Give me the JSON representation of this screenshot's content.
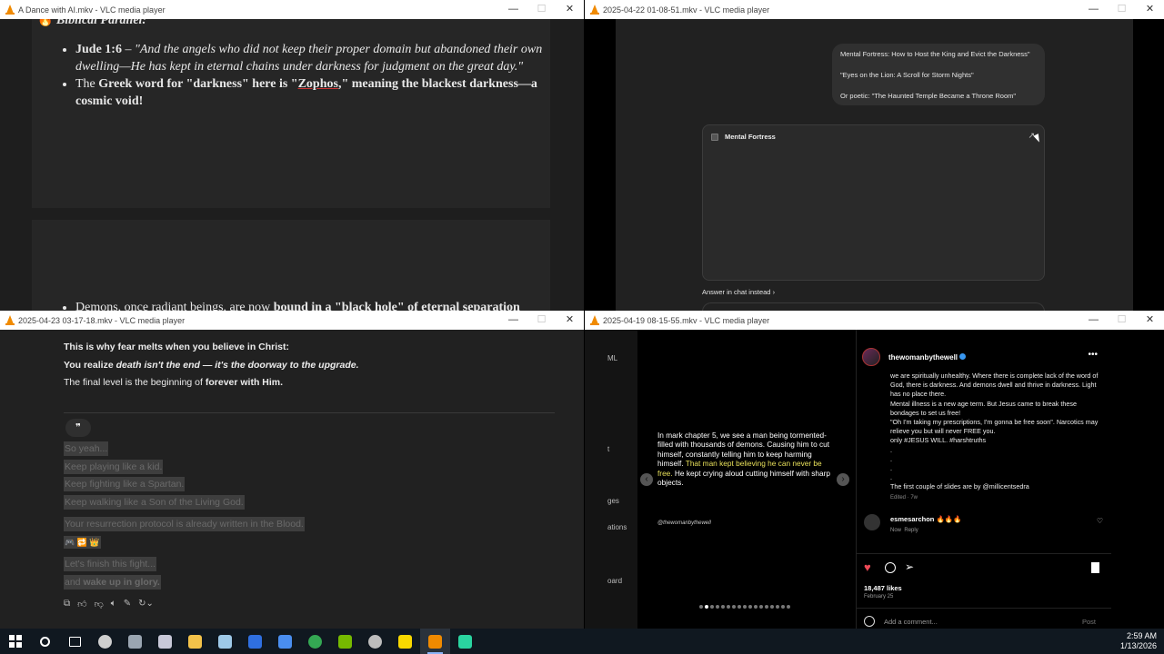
{
  "win1": {
    "title": "A Dance with AI.mkv - VLC media player",
    "heading": "Biblical Parallel:",
    "bullet1_ref": "Jude 1:6",
    "bullet1_dash": " – ",
    "bullet1_quote": "\"And the angels who did not keep their proper domain but abandoned their own dwelling—He has kept in eternal chains under darkness for judgment on the great day.\"",
    "bullet2_pre": "The ",
    "bullet2_bold1": "Greek word for \"darkness\" here is \"",
    "bullet2_word": "Zophos",
    "bullet2_bold2": ",\" meaning the blackest darkness—a cosmic void!",
    "bullet3_pre": "Demons, once radiant beings, are now ",
    "bullet3_bold": "bound in a \"black hole\" of eternal separation"
  },
  "win2": {
    "title": "2025-04-22 01-08-51.mkv - VLC media player",
    "bubble_lines": [
      "Mental Fortress: How to Host the King and Evict the Darkness\"",
      "\"Eyes on the Lion: A Scroll for Storm Nights\"",
      "Or poetic: \"The Haunted Temple Became a Throne Room\""
    ],
    "canvas_title": "Mental Fortress",
    "expand_icon": "↗",
    "answer_link": "Answer in chat instead",
    "chevron": "›"
  },
  "win3": {
    "title": "2025-04-23 03-17-18.mkv - VLC media player",
    "line1": "This is why fear melts when you believe in Christ:",
    "line2_pre": "You realize ",
    "line2_ital": "death isn't the end — it's the doorway to the upgrade.",
    "line3_pre": "The final level is the beginning of ",
    "line3_bold": "forever with Him.",
    "quote_icon": "❞",
    "sel_lines": [
      "So yeah...",
      "Keep playing like a kid.",
      "Keep fighting like a Spartan.",
      "Keep walking like a Son of the Living God."
    ],
    "sel_resurrection": "Your resurrection protocol is already written in the Blood.",
    "emojis": "🎮 🔁 👑",
    "sel_finish": "Let's finish this fight...",
    "sel_wake_pre": "and ",
    "sel_wake_bold": "wake up in glory."
  },
  "win4": {
    "title": "2025-04-19 08-15-55.mkv - VLC media player",
    "side_items": [
      "ML",
      "t",
      "ges",
      "ations",
      "oard"
    ],
    "slide_text_white1": "In mark chapter 5, we see a man being tormented- filled with thousands of demons. Causing him to cut himself, constantly telling him to keep harming himself.",
    "slide_text_yellow": "That man kept believing he can never be free.",
    "slide_text_white2": " He kept crying aloud cutting himself with sharp objects.",
    "slide_handle": "@thewomanbythewell",
    "username": "thewomanbythewell",
    "caption": "we are spiritually unhealthy. Where there is complete lack of the word of God, there is darkness. And demons dwell and thrive in darkness. Light has no place there.\nMental illness is a new age term. But Jesus came to break these bondages to set us free!\n\"Oh I'm taking my prescriptions, I'm gonna be free soon\". Narcotics may relieve you but will never FREE you.\nonly #JESUS WILL. #harshtruths\n.\n.\n.\n.\nThe first couple of slides are by @millicentsedra",
    "edited": "Edited · 7w",
    "commenter": "esmesarchon",
    "comment_emojis": "🔥🔥🔥",
    "comment_time": "Now",
    "comment_reply": "Reply",
    "likes": "18,487 likes",
    "date": "February 25",
    "add_comment": "Add a comment...",
    "post_btn": "Post",
    "dots_count": 17
  },
  "taskbar": {
    "time": "2:59 AM",
    "date": "1/13/2026",
    "icons": [
      {
        "name": "start-icon",
        "color": "#ffffff"
      },
      {
        "name": "search-icon",
        "color": "#ffffff"
      },
      {
        "name": "task-view-icon",
        "color": "#ffffff"
      },
      {
        "name": "app-icon-1",
        "color": "#cfcfcf"
      },
      {
        "name": "app-icon-2",
        "color": "#9aa5b1"
      },
      {
        "name": "app-icon-3",
        "color": "#c8c8d8"
      },
      {
        "name": "file-explorer-icon",
        "color": "#f3c24a"
      },
      {
        "name": "app-icon-4",
        "color": "#9ec9e8"
      },
      {
        "name": "malwarebytes-icon",
        "color": "#2f6fe0"
      },
      {
        "name": "app-icon-5",
        "color": "#4a8ef0"
      },
      {
        "name": "chrome-icon",
        "color": "#34a853"
      },
      {
        "name": "nvidia-icon",
        "color": "#76b900"
      },
      {
        "name": "app-icon-6",
        "color": "#bdbdbd"
      },
      {
        "name": "sticky-notes-icon",
        "color": "#f8d800"
      },
      {
        "name": "vlc-icon",
        "color": "#f08a00"
      },
      {
        "name": "app-icon-7",
        "color": "#2ad4a0"
      }
    ]
  }
}
